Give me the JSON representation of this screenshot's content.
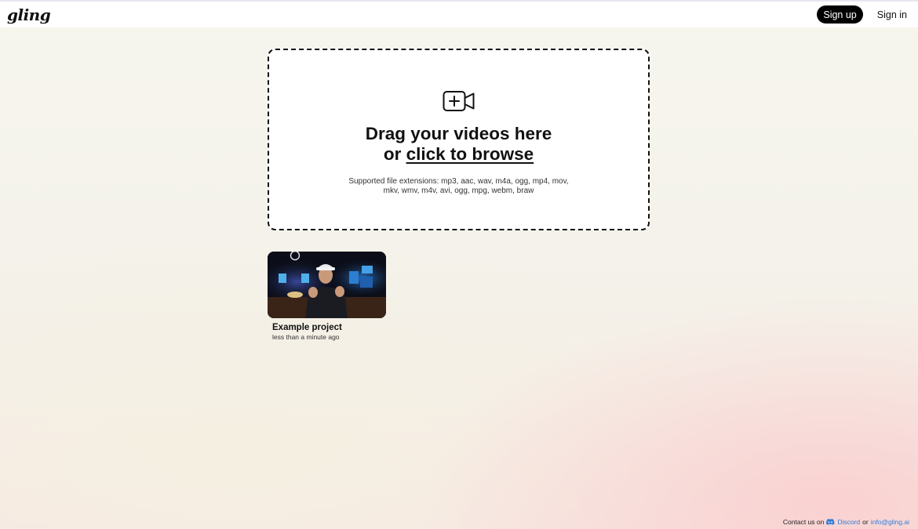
{
  "brand": {
    "logo_text": "gling"
  },
  "header": {
    "signup_label": "Sign up",
    "signin_label": "Sign in"
  },
  "upload": {
    "headline_line1": "Drag your videos here",
    "headline_or": "or ",
    "browse_label": "click to browse",
    "supported_text": "Supported file extensions: mp3, aac, wav, m4a, ogg, mp4, mov, mkv, wmv, m4v, avi, ogg, mpg, webm, braw",
    "icon": "video-add-icon"
  },
  "projects": [
    {
      "title": "Example project",
      "time": "less than a minute ago"
    }
  ],
  "footer": {
    "contact_prefix": "Contact us on",
    "discord_label": "Discord",
    "or_text": "or",
    "email_label": "info@gling.ai"
  },
  "colors": {
    "accent_link": "#2f7fdc",
    "primary_button": "#000000"
  }
}
